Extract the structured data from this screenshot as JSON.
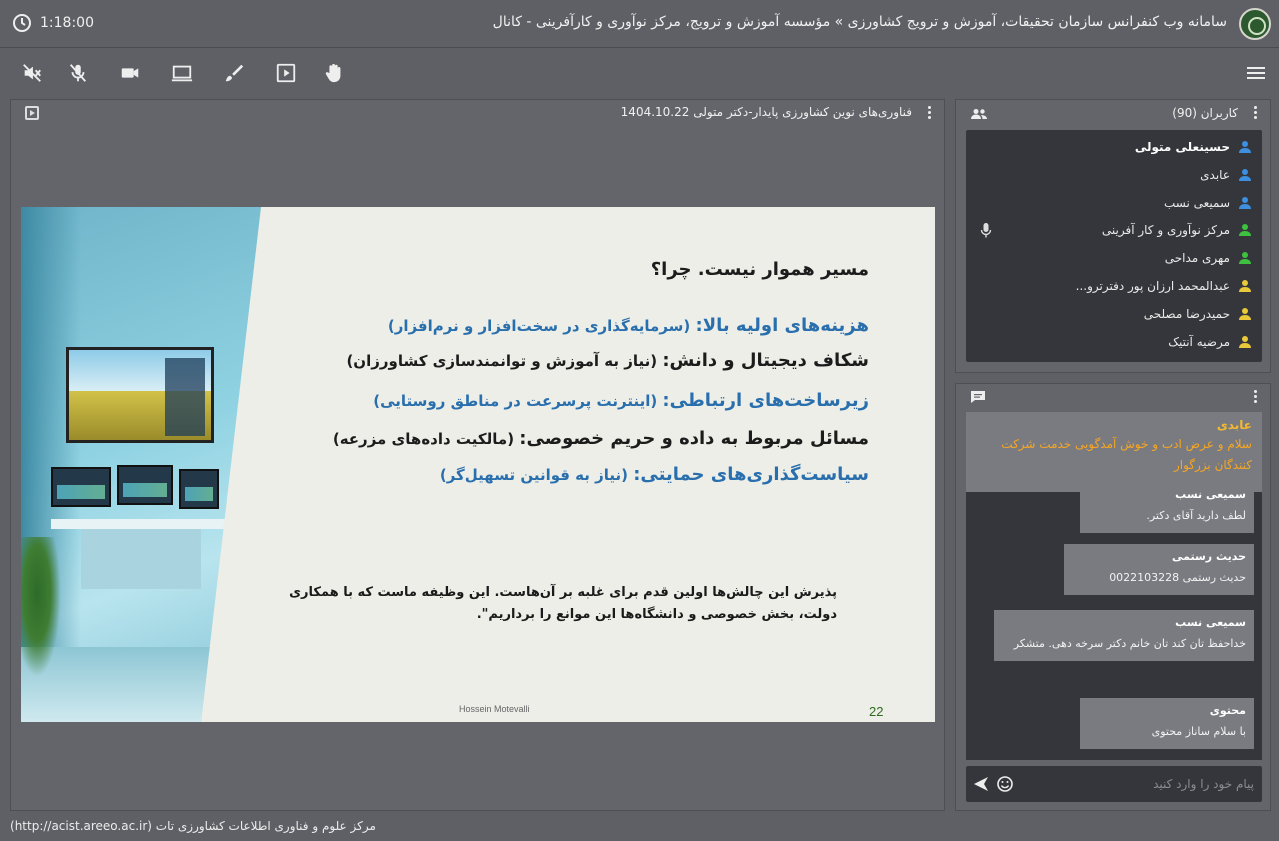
{
  "header": {
    "title": "سامانه وب کنفرانس سازمان تحقیقات، آموزش و ترویج کشاورزی » مؤسسه آموزش و ترویج، مرکز نوآوری و کارآفرینی - کانال",
    "timer": "1:18:00",
    "timer_icon": "clock-icon",
    "logo_icon": "organization-logo"
  },
  "toolbar": {
    "buttons": [
      {
        "name": "speaker-off-icon"
      },
      {
        "name": "mic-off-icon"
      },
      {
        "name": "camera-icon"
      },
      {
        "name": "screen-share-icon"
      },
      {
        "name": "brush-icon"
      },
      {
        "name": "play-presentation-icon"
      },
      {
        "name": "raise-hand-icon"
      }
    ],
    "menu_icon": "hamburger-menu-icon"
  },
  "presentation": {
    "title": "فناوری‌های نوین کشاورزی پایدار-دکتر متولی 1404.10.22",
    "slide": {
      "heading": "مسیر هموار نیست. چرا؟",
      "lines": [
        {
          "main": "هزینه‌های اولیه بالا:",
          "sub": " (سرمایه‌گذاری در سخت‌افزار و نرم‌افزار)"
        },
        {
          "main": "شکاف دیجیتال و دانش:",
          "sub": " (نیاز به آموزش و توانمندسازی کشاورزان)"
        },
        {
          "main": "زیرساخت‌های ارتباطی:",
          "sub": " (اینترنت پرسرعت در مناطق روستایی)"
        },
        {
          "main": "مسائل مربوط به داده و حریم خصوصی:",
          "sub": " (مالکیت داده‌های مزرعه)"
        },
        {
          "main": "سیاست‌گذاری‌های حمایتی:",
          "sub": " (نیاز به قوانین تسهیل‌گر)"
        }
      ],
      "quote": "پذیرش این چالش‌ها اولین قدم برای غلبه بر آن‌هاست. این وظیفه ماست که با همکاری دولت، بخش خصوصی و دانشگاه‌ها این موانع را برداریم\".",
      "author": "Hossein Motevalli",
      "page": "22"
    }
  },
  "users": {
    "title": "کاربران (90)",
    "list": [
      {
        "name": "حسینعلی متولی",
        "color": "#3d8fe0",
        "bold": true
      },
      {
        "name": "عابدی",
        "color": "#3d8fe0",
        "bold": false
      },
      {
        "name": "سمیعی نسب",
        "color": "#3d8fe0",
        "bold": false
      },
      {
        "name": "مرکز نوآوری و کار آفرینی",
        "color": "#3ec13e",
        "bold": false,
        "mic": true
      },
      {
        "name": "مهری مداحی",
        "color": "#3ec13e",
        "bold": false
      },
      {
        "name": "عبدالمحمد ارزان پور دفترترو...",
        "color": "#e8c93a",
        "bold": false
      },
      {
        "name": "حمیدرضا مصلحی",
        "color": "#e8c93a",
        "bold": false
      },
      {
        "name": "مرضیه آنتیک",
        "color": "#e8c93a",
        "bold": false
      }
    ]
  },
  "chat": {
    "pinned": {
      "name": "عابدی",
      "text": "سلام و عرض ادب و خوش آمدگویی خدمت شرکت کنندگان بزرگوار"
    },
    "messages": [
      {
        "name": "سمیعی نسب",
        "text": "لطف دارید آقای دکتر."
      },
      {
        "name": "حدیث رستمی",
        "text": "حدیث رستمی 0022103228"
      },
      {
        "name": "سمیعی نسب",
        "text": "خداحفظ تان کند تان خانم دکتر سرخه دهی. متشکر"
      },
      {
        "name": "محتوی",
        "text": "با سلام ساناز محتوی"
      }
    ],
    "input_placeholder": "پیام خود را وارد کنید"
  },
  "footer": {
    "text": "مرکز علوم و فناوری اطلاعات کشاورزی تات (http://acist.areeo.ac.ir)"
  }
}
